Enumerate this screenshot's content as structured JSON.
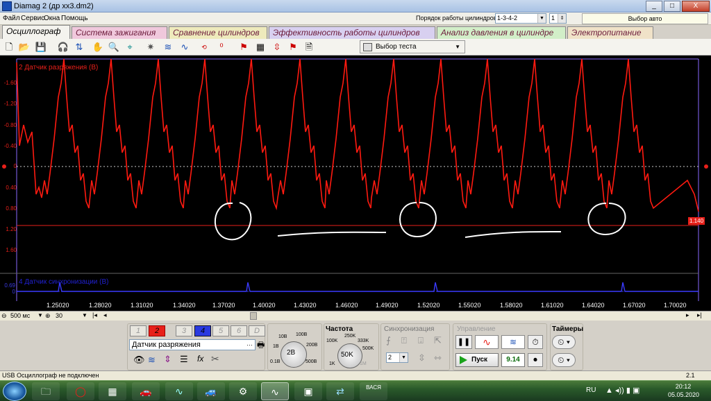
{
  "window": {
    "title": "Diamag 2 (др хх3.dm2)",
    "buttons": [
      "_",
      "□",
      "X"
    ]
  },
  "menu": {
    "items": [
      "Файл",
      "Сервис",
      "Окна",
      "Помощь"
    ]
  },
  "header": {
    "cyl_order_label": "Порядок работы цилиндров",
    "cyl_order_value": "1-3-4-2",
    "cyl_number": "1",
    "auto_select": "Выбор авто"
  },
  "tabs": [
    {
      "label": "Осциллограф",
      "active": true
    },
    {
      "label": "Система зажигания"
    },
    {
      "label": "Сравнение цилиндров"
    },
    {
      "label": "Эффективность работы цилиндров"
    },
    {
      "label": "Анализ давления в цилиндре"
    },
    {
      "label": "Электропитание"
    }
  ],
  "toolbar": {
    "test_select": "Выбор теста"
  },
  "scope": {
    "ch2_label": "2 Датчик разряжения (В)",
    "ch4_label": "4 Датчик синхронизации (В)",
    "ch2_yticks": [
      "-1.60",
      "-1.20",
      "-0.80",
      "-0.40",
      "0",
      "0.40",
      "0.80",
      "1.20",
      "1.60"
    ],
    "ch4_yticks": [
      "0.69",
      "0"
    ],
    "cursor_value": "1.140",
    "xticks": [
      "1.25020",
      "1.28020",
      "1.31020",
      "1.34020",
      "1.37020",
      "1.40020",
      "1.43020",
      "1.46020",
      "1.49020",
      "1.52020",
      "1.55020",
      "1.58020",
      "1.61020",
      "1.64020",
      "1.67020",
      "1.70020"
    ],
    "colors": {
      "ch2": "#e8201a",
      "ch4": "#2020ff",
      "annotation": "#ffffff"
    }
  },
  "hscroll": {
    "timebase": "500 мс",
    "zoom": "30"
  },
  "panel": {
    "channels": [
      "1",
      "2",
      "3",
      "4",
      "5",
      "6",
      "D"
    ],
    "sensor": "Датчик разряжения",
    "voltage_knob": {
      "value": "2В",
      "labels": [
        "10В",
        "100В",
        "1В",
        "200В",
        "0.1В",
        "500В"
      ]
    },
    "freq_title": "Частота",
    "freq_knob": {
      "value": "50K",
      "labels": [
        "250K",
        "100K",
        "333K",
        "500K",
        "1K",
        "1M"
      ]
    },
    "sync_title": "Синхронизация",
    "sync_channel": "2",
    "control_title": "Управление",
    "start_label": "Пуск",
    "rpm_value": "9.14",
    "timers_title": "Таймеры"
  },
  "status": {
    "message": "USB Осциллограф не подключен",
    "version": "2.1"
  },
  "taskbar": {
    "lang": "RU",
    "time": "20:12",
    "date": "05.05.2020"
  }
}
